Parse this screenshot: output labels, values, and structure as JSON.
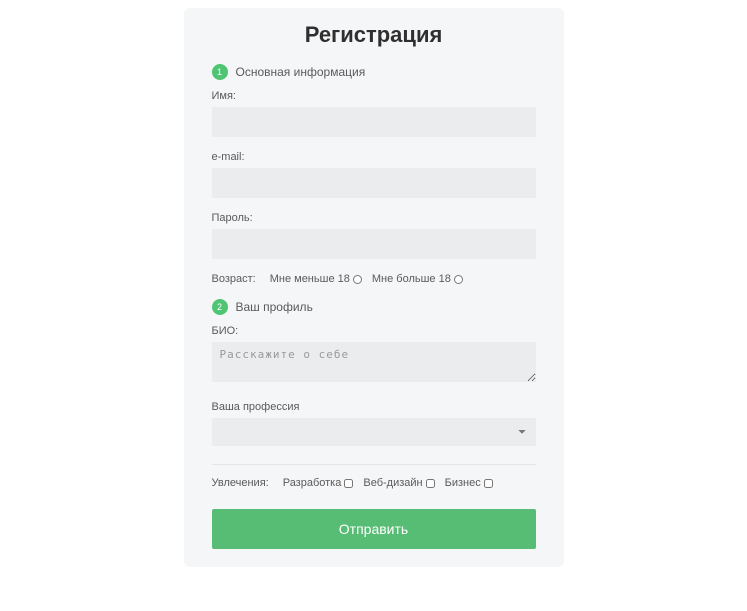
{
  "title": "Регистрация",
  "section1": {
    "step": "1",
    "heading": "Основная информация",
    "name_label": "Имя:",
    "email_label": "e-mail:",
    "password_label": "Пароль:",
    "age_label": "Возраст:",
    "age_option_under": "Мне меньше 18",
    "age_option_over": "Мне больше 18"
  },
  "section2": {
    "step": "2",
    "heading": "Ваш профиль",
    "bio_label": "БИО:",
    "bio_placeholder": "Расскажите о себе",
    "profession_label": "Ваша профессия",
    "hobbies_label": "Увлечения:",
    "hobby_dev": "Разработка",
    "hobby_design": "Веб-дизайн",
    "hobby_business": "Бизнес"
  },
  "submit_label": "Отправить"
}
